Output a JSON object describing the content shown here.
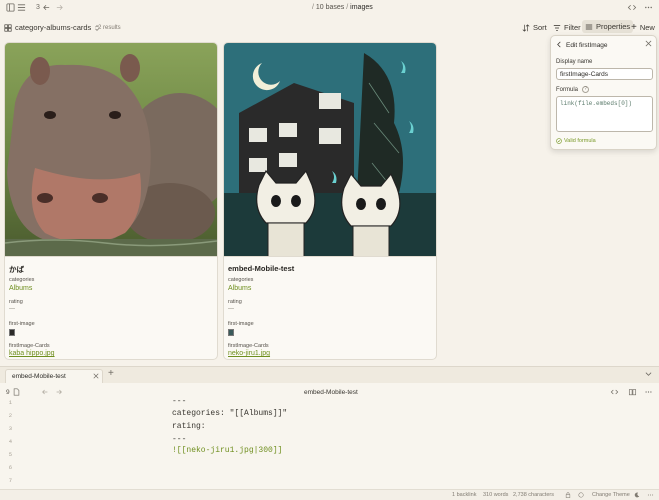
{
  "topbar": {
    "history_count": "3",
    "breadcrumb_parent": "10 bases",
    "breadcrumb_sep": "/",
    "breadcrumb_current": "images"
  },
  "base": {
    "view_name": "category-albums-cards",
    "results": "2 results",
    "sort_label": "Sort",
    "filter_label": "Filter",
    "properties_label": "Properties",
    "new_label": "New"
  },
  "cards": [
    {
      "title": "かば",
      "categories_label": "categories",
      "categories_value": "Albums",
      "rating_label": "rating",
      "rating_value": "—",
      "first_image_label": "first-image",
      "firstimage_cards_label": "firstImage-Cards",
      "firstimage_cards_value": "kaba hippo.jpg"
    },
    {
      "title": "embed-Mobile-test",
      "categories_label": "categories",
      "categories_value": "Albums",
      "rating_label": "rating",
      "rating_value": "—",
      "first_image_label": "first-image",
      "firstimage_cards_label": "firstImage-Cards",
      "firstimage_cards_value": "neko-jiru1.jpg"
    }
  ],
  "popup": {
    "title": "Edit firstImage",
    "display_name_label": "Display name",
    "display_name_value": "firstImage-Cards",
    "formula_label": "Formula",
    "formula_value": "link(file.embeds[0])",
    "valid_label": "Valid formula"
  },
  "editor": {
    "tab_title": "embed-Mobile-test",
    "header_title": "embed-Mobile-test",
    "backlink_count": "9",
    "lines": [
      {
        "num": "1",
        "text": "---"
      },
      {
        "num": "2",
        "text": "categories: \"[[Albums]]\""
      },
      {
        "num": "3",
        "text": "rating:"
      },
      {
        "num": "4",
        "text": "---"
      },
      {
        "num": "5",
        "text": "![[neko-jiru1.jpg|300]]"
      },
      {
        "num": "6",
        "text": ""
      },
      {
        "num": "7",
        "text": ""
      }
    ]
  },
  "status": {
    "backlinks": "1 backlink",
    "words": "310 words",
    "characters": "2,738 characters",
    "theme": "Change Theme"
  },
  "colors": {
    "accent": "#7a9a2a",
    "background": "#f6f2ea",
    "card_bg": "#fbf9f4"
  }
}
